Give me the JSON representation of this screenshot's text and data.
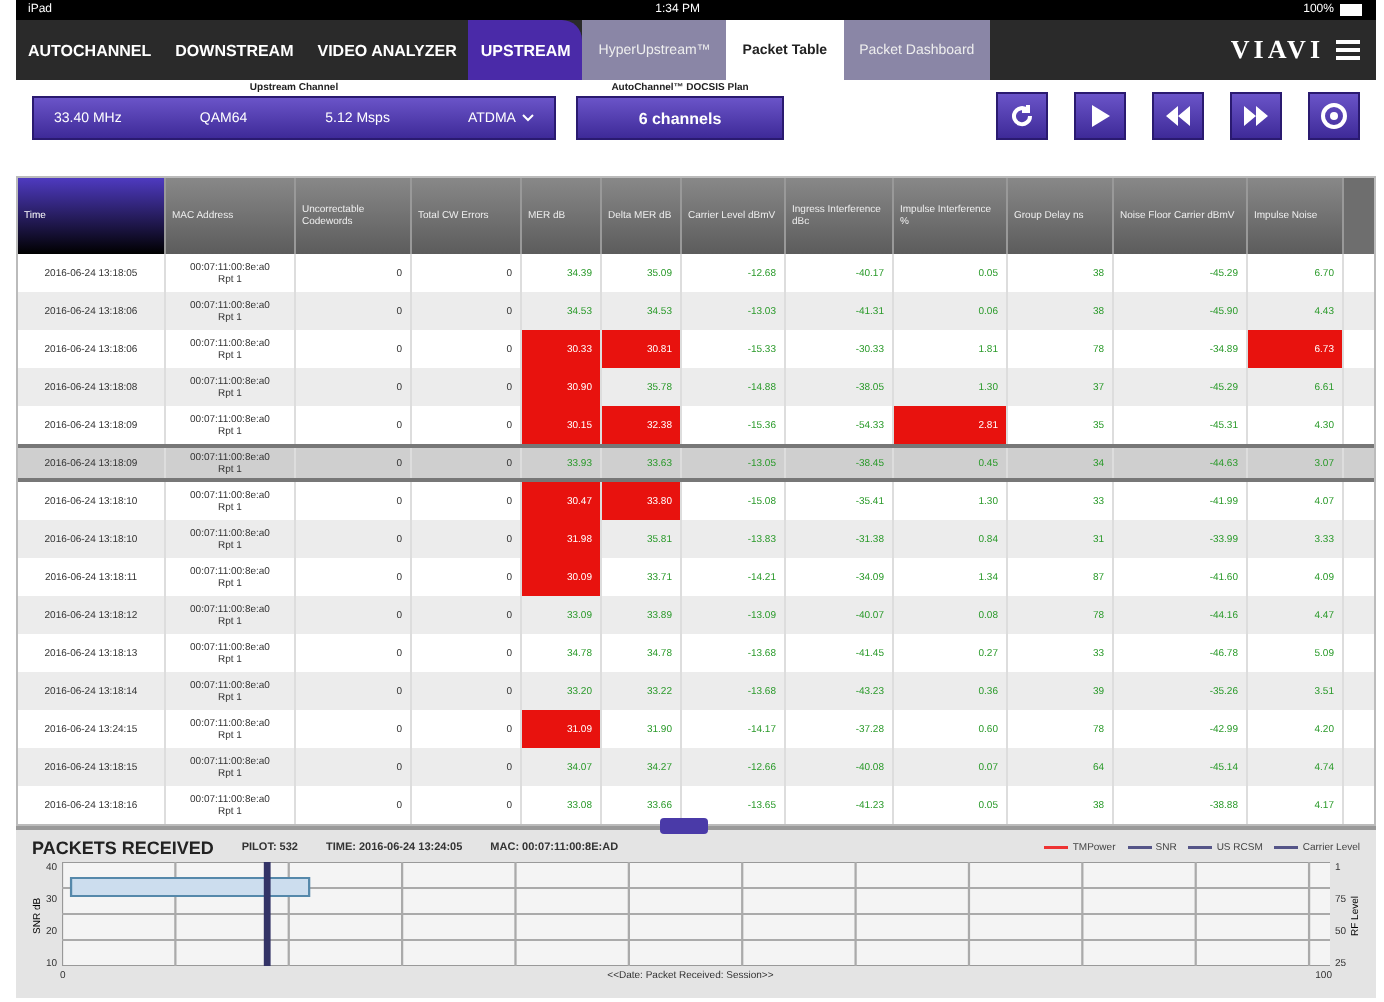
{
  "status_bar": {
    "device": "iPad",
    "time": "1:34 PM",
    "battery": "100%"
  },
  "main_tabs": [
    {
      "label": "AUTOCHANNEL",
      "selected": false
    },
    {
      "label": "DOWNSTREAM",
      "selected": false
    },
    {
      "label": "VIDEO ANALYZER",
      "selected": false
    },
    {
      "label": "UPSTREAM",
      "selected": true
    }
  ],
  "sub_tabs": [
    {
      "label": "HyperUpstream™",
      "selected": false
    },
    {
      "label": "Packet Table",
      "selected": true
    },
    {
      "label": "Packet Dashboard",
      "selected": false
    }
  ],
  "brand": "VIAVI",
  "upstream_channel": {
    "label": "Upstream Channel",
    "frequency": "33.40 MHz",
    "modulation": "QAM64",
    "symbol_rate": "5.12 Msps",
    "mode": "ATDMA"
  },
  "docsis_plan": {
    "label": "AutoChannel™ DOCSIS Plan",
    "value": "6 channels"
  },
  "table": {
    "columns": [
      {
        "label": "Time",
        "selected": true
      },
      {
        "label": "MAC Address",
        "selected": false
      },
      {
        "label": "Uncorrectable Codewords",
        "selected": false
      },
      {
        "label": "Total CW Errors",
        "selected": false
      },
      {
        "label": "MER dB",
        "selected": false
      },
      {
        "label": "Delta MER dB",
        "selected": false
      },
      {
        "label": "Carrier Level dBmV",
        "selected": false
      },
      {
        "label": "Ingress Interference dBc",
        "selected": false
      },
      {
        "label": "Impulse Interference %",
        "selected": false
      },
      {
        "label": "Group Delay ns",
        "selected": false
      },
      {
        "label": "Noise Floor Carrier dBmV",
        "selected": false
      },
      {
        "label": "Impulse Noise",
        "selected": false
      }
    ],
    "rows": [
      {
        "selected": false,
        "cells": [
          "2016-06-24 13:18:05",
          "00:07:11:00:8e:a0\nRpt 1",
          "0",
          "0",
          "34.39",
          "35.09",
          "-12.68",
          "-40.17",
          "0.05",
          "38",
          "-45.29",
          "6.70"
        ],
        "alarm": [
          false,
          false,
          false,
          false,
          false,
          false,
          false,
          false,
          false,
          false,
          false,
          false
        ]
      },
      {
        "selected": false,
        "cells": [
          "2016-06-24 13:18:06",
          "00:07:11:00:8e:a0\nRpt 1",
          "0",
          "0",
          "34.53",
          "34.53",
          "-13.03",
          "-41.31",
          "0.06",
          "38",
          "-45.90",
          "4.43"
        ],
        "alarm": [
          false,
          false,
          false,
          false,
          false,
          false,
          false,
          false,
          false,
          false,
          false,
          false
        ]
      },
      {
        "selected": false,
        "cells": [
          "2016-06-24 13:18:06",
          "00:07:11:00:8e:a0\nRpt 1",
          "0",
          "0",
          "30.33",
          "30.81",
          "-15.33",
          "-30.33",
          "1.81",
          "78",
          "-34.89",
          "6.73"
        ],
        "alarm": [
          false,
          false,
          false,
          false,
          true,
          true,
          false,
          false,
          false,
          false,
          false,
          true
        ]
      },
      {
        "selected": false,
        "cells": [
          "2016-06-24 13:18:08",
          "00:07:11:00:8e:a0\nRpt 1",
          "0",
          "0",
          "30.90",
          "35.78",
          "-14.88",
          "-38.05",
          "1.30",
          "37",
          "-45.29",
          "6.61"
        ],
        "alarm": [
          false,
          false,
          false,
          false,
          true,
          false,
          false,
          false,
          false,
          false,
          false,
          false
        ]
      },
      {
        "selected": false,
        "cells": [
          "2016-06-24 13:18:09",
          "00:07:11:00:8e:a0\nRpt 1",
          "0",
          "0",
          "30.15",
          "32.38",
          "-15.36",
          "-54.33",
          "2.81",
          "35",
          "-45.31",
          "4.30"
        ],
        "alarm": [
          false,
          false,
          false,
          false,
          true,
          true,
          false,
          false,
          true,
          false,
          false,
          false
        ]
      },
      {
        "selected": true,
        "cells": [
          "2016-06-24 13:18:09",
          "00:07:11:00:8e:a0\nRpt 1",
          "0",
          "0",
          "33.93",
          "33.63",
          "-13.05",
          "-38.45",
          "0.45",
          "34",
          "-44.63",
          "3.07"
        ],
        "alarm": [
          false,
          false,
          false,
          false,
          false,
          false,
          false,
          false,
          false,
          false,
          false,
          false
        ]
      },
      {
        "selected": false,
        "cells": [
          "2016-06-24 13:18:10",
          "00:07:11:00:8e:a0\nRpt 1",
          "0",
          "0",
          "30.47",
          "33.80",
          "-15.08",
          "-35.41",
          "1.30",
          "33",
          "-41.99",
          "4.07"
        ],
        "alarm": [
          false,
          false,
          false,
          false,
          true,
          true,
          false,
          false,
          false,
          false,
          false,
          false
        ]
      },
      {
        "selected": false,
        "cells": [
          "2016-06-24 13:18:10",
          "00:07:11:00:8e:a0\nRpt 1",
          "0",
          "0",
          "31.98",
          "35.81",
          "-13.83",
          "-31.38",
          "0.84",
          "31",
          "-33.99",
          "3.33"
        ],
        "alarm": [
          false,
          false,
          false,
          false,
          true,
          false,
          false,
          false,
          false,
          false,
          false,
          false
        ]
      },
      {
        "selected": false,
        "cells": [
          "2016-06-24 13:18:11",
          "00:07:11:00:8e:a0\nRpt 1",
          "0",
          "0",
          "30.09",
          "33.71",
          "-14.21",
          "-34.09",
          "1.34",
          "87",
          "-41.60",
          "4.09"
        ],
        "alarm": [
          false,
          false,
          false,
          false,
          true,
          false,
          false,
          false,
          false,
          false,
          false,
          false
        ]
      },
      {
        "selected": false,
        "cells": [
          "2016-06-24 13:18:12",
          "00:07:11:00:8e:a0\nRpt 1",
          "0",
          "0",
          "33.09",
          "33.89",
          "-13.09",
          "-40.07",
          "0.08",
          "78",
          "-44.16",
          "4.47"
        ],
        "alarm": [
          false,
          false,
          false,
          false,
          false,
          false,
          false,
          false,
          false,
          false,
          false,
          false
        ]
      },
      {
        "selected": false,
        "cells": [
          "2016-06-24 13:18:13",
          "00:07:11:00:8e:a0\nRpt 1",
          "0",
          "0",
          "34.78",
          "34.78",
          "-13.68",
          "-41.45",
          "0.27",
          "33",
          "-46.78",
          "5.09"
        ],
        "alarm": [
          false,
          false,
          false,
          false,
          false,
          false,
          false,
          false,
          false,
          false,
          false,
          false
        ]
      },
      {
        "selected": false,
        "cells": [
          "2016-06-24 13:18:14",
          "00:07:11:00:8e:a0\nRpt 1",
          "0",
          "0",
          "33.20",
          "33.22",
          "-13.68",
          "-43.23",
          "0.36",
          "39",
          "-35.26",
          "3.51"
        ],
        "alarm": [
          false,
          false,
          false,
          false,
          false,
          false,
          false,
          false,
          false,
          false,
          false,
          false
        ]
      },
      {
        "selected": false,
        "cells": [
          "2016-06-24 13:24:15",
          "00:07:11:00:8e:a0\nRpt 1",
          "0",
          "0",
          "31.09",
          "31.90",
          "-14.17",
          "-37.28",
          "0.60",
          "78",
          "-42.99",
          "4.20"
        ],
        "alarm": [
          false,
          false,
          false,
          false,
          true,
          false,
          false,
          false,
          false,
          false,
          false,
          false
        ]
      },
      {
        "selected": false,
        "cells": [
          "2016-06-24 13:18:15",
          "00:07:11:00:8e:a0\nRpt 1",
          "0",
          "0",
          "34.07",
          "34.27",
          "-12.66",
          "-40.08",
          "0.07",
          "64",
          "-45.14",
          "4.74"
        ],
        "alarm": [
          false,
          false,
          false,
          false,
          false,
          false,
          false,
          false,
          false,
          false,
          false,
          false
        ]
      },
      {
        "selected": false,
        "cells": [
          "2016-06-24 13:18:16",
          "00:07:11:00:8e:a0\nRpt 1",
          "0",
          "0",
          "33.08",
          "33.66",
          "-13.65",
          "-41.23",
          "0.05",
          "38",
          "-38.88",
          "4.17"
        ],
        "alarm": [
          false,
          false,
          false,
          false,
          false,
          false,
          false,
          false,
          false,
          false,
          false,
          false
        ]
      }
    ]
  },
  "chart_panel": {
    "title": "PACKETS RECEIVED",
    "pilot": "PILOT: 532",
    "time": "TIME: 2016-06-24 13:24:05",
    "mac": "MAC: 00:07:11:00:8E:AD",
    "legend": [
      "TMPower",
      "SNR",
      "US RCSM",
      "Carrier Level"
    ],
    "left_axis": "SNR dB",
    "right_axis": "RF Level",
    "left_ticks": [
      "40",
      "30",
      "20",
      "10"
    ],
    "right_ticks": [
      "1",
      "75",
      "50",
      "25"
    ],
    "x_start": "0",
    "x_end": "100",
    "x_caption": "<<Date: Packet Received: Session>>"
  }
}
